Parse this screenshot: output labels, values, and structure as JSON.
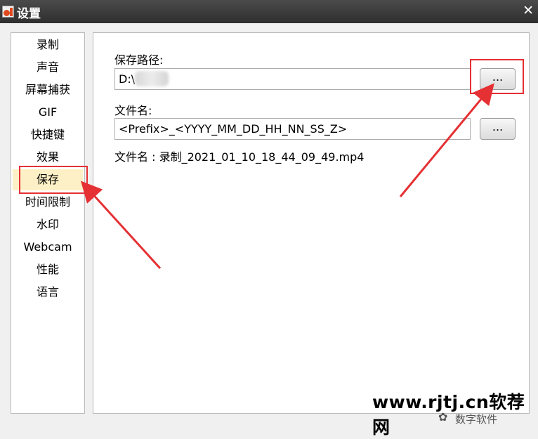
{
  "window": {
    "title": "设置",
    "close_glyph": "✕"
  },
  "sidebar": {
    "items": [
      {
        "label": "录制"
      },
      {
        "label": "声音"
      },
      {
        "label": "屏幕捕获"
      },
      {
        "label": "GIF"
      },
      {
        "label": "快捷键"
      },
      {
        "label": "效果"
      },
      {
        "label": "保存",
        "selected": true
      },
      {
        "label": "时间限制"
      },
      {
        "label": "水印"
      },
      {
        "label": "Webcam"
      },
      {
        "label": "性能"
      },
      {
        "label": "语言"
      }
    ]
  },
  "save_settings": {
    "path_label": "保存路径:",
    "path_value": "D:\\",
    "browse_label": "...",
    "filename_label": "文件名:",
    "filename_value": "<Prefix>_<YYYY_MM_DD_HH_NN_SS_Z>",
    "filename_browse_label": "...",
    "filename_preview": "文件名 : 录制_2021_01_10_18_44_09_49.mp4"
  },
  "annotations": {
    "highlight_color": "#e53034"
  },
  "watermark": {
    "site": "www.rjtj.cn软荐网",
    "sub": "数字软件"
  },
  "colors": {
    "titlebar": "#3a3a3a",
    "selected_bg": "#fdf0c6",
    "window_bg": "#f0f0f0"
  }
}
